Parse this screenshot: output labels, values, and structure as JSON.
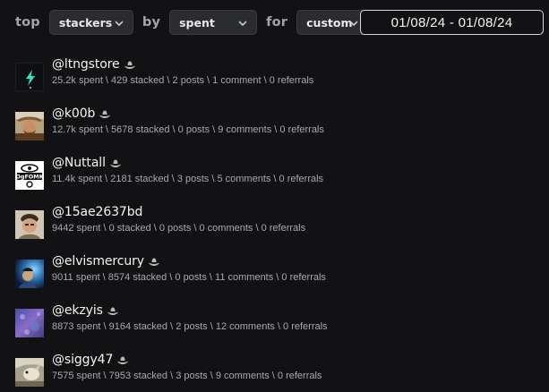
{
  "filter_bar": {
    "word_top": "top",
    "type_select": "stackers",
    "word_by": "by",
    "by_select": "spent",
    "word_for": "for",
    "when_select": "custom",
    "date_range": "01/08/24 - 01/08/24"
  },
  "icons": {
    "chevron": "chevron-down-icon",
    "cowboy_hat": "cowboy-hat-icon"
  },
  "colors": {
    "background": "#121214",
    "accent_text": "#a2a4a8",
    "stats_text": "#a7a9ad"
  },
  "users": [
    {
      "name": "@ltngstore",
      "hat": true,
      "stats": "25.2k spent \\ 429 stacked \\ 2 posts \\ 1 comment \\ 0 referrals"
    },
    {
      "name": "@k00b",
      "hat": true,
      "stats": "12.7k spent \\ 5678 stacked \\ 0 posts \\ 9 comments \\ 0 referrals"
    },
    {
      "name": "@Nuttall",
      "hat": true,
      "stats": "11.4k spent \\ 2181 stacked \\ 3 posts \\ 5 comments \\ 0 referrals",
      "avatar_text": "OgFOMK"
    },
    {
      "name": "@15ae2637bd",
      "hat": false,
      "stats": "9442 spent \\ 0 stacked \\ 0 posts \\ 0 comments \\ 0 referrals"
    },
    {
      "name": "@elvismercury",
      "hat": true,
      "stats": "9011 spent \\ 8574 stacked \\ 0 posts \\ 11 comments \\ 0 referrals"
    },
    {
      "name": "@ekzyis",
      "hat": true,
      "stats": "8873 spent \\ 9164 stacked \\ 2 posts \\ 12 comments \\ 0 referrals"
    },
    {
      "name": "@siggy47",
      "hat": true,
      "stats": "7575 spent \\ 7953 stacked \\ 3 posts \\ 9 comments \\ 0 referrals"
    }
  ]
}
